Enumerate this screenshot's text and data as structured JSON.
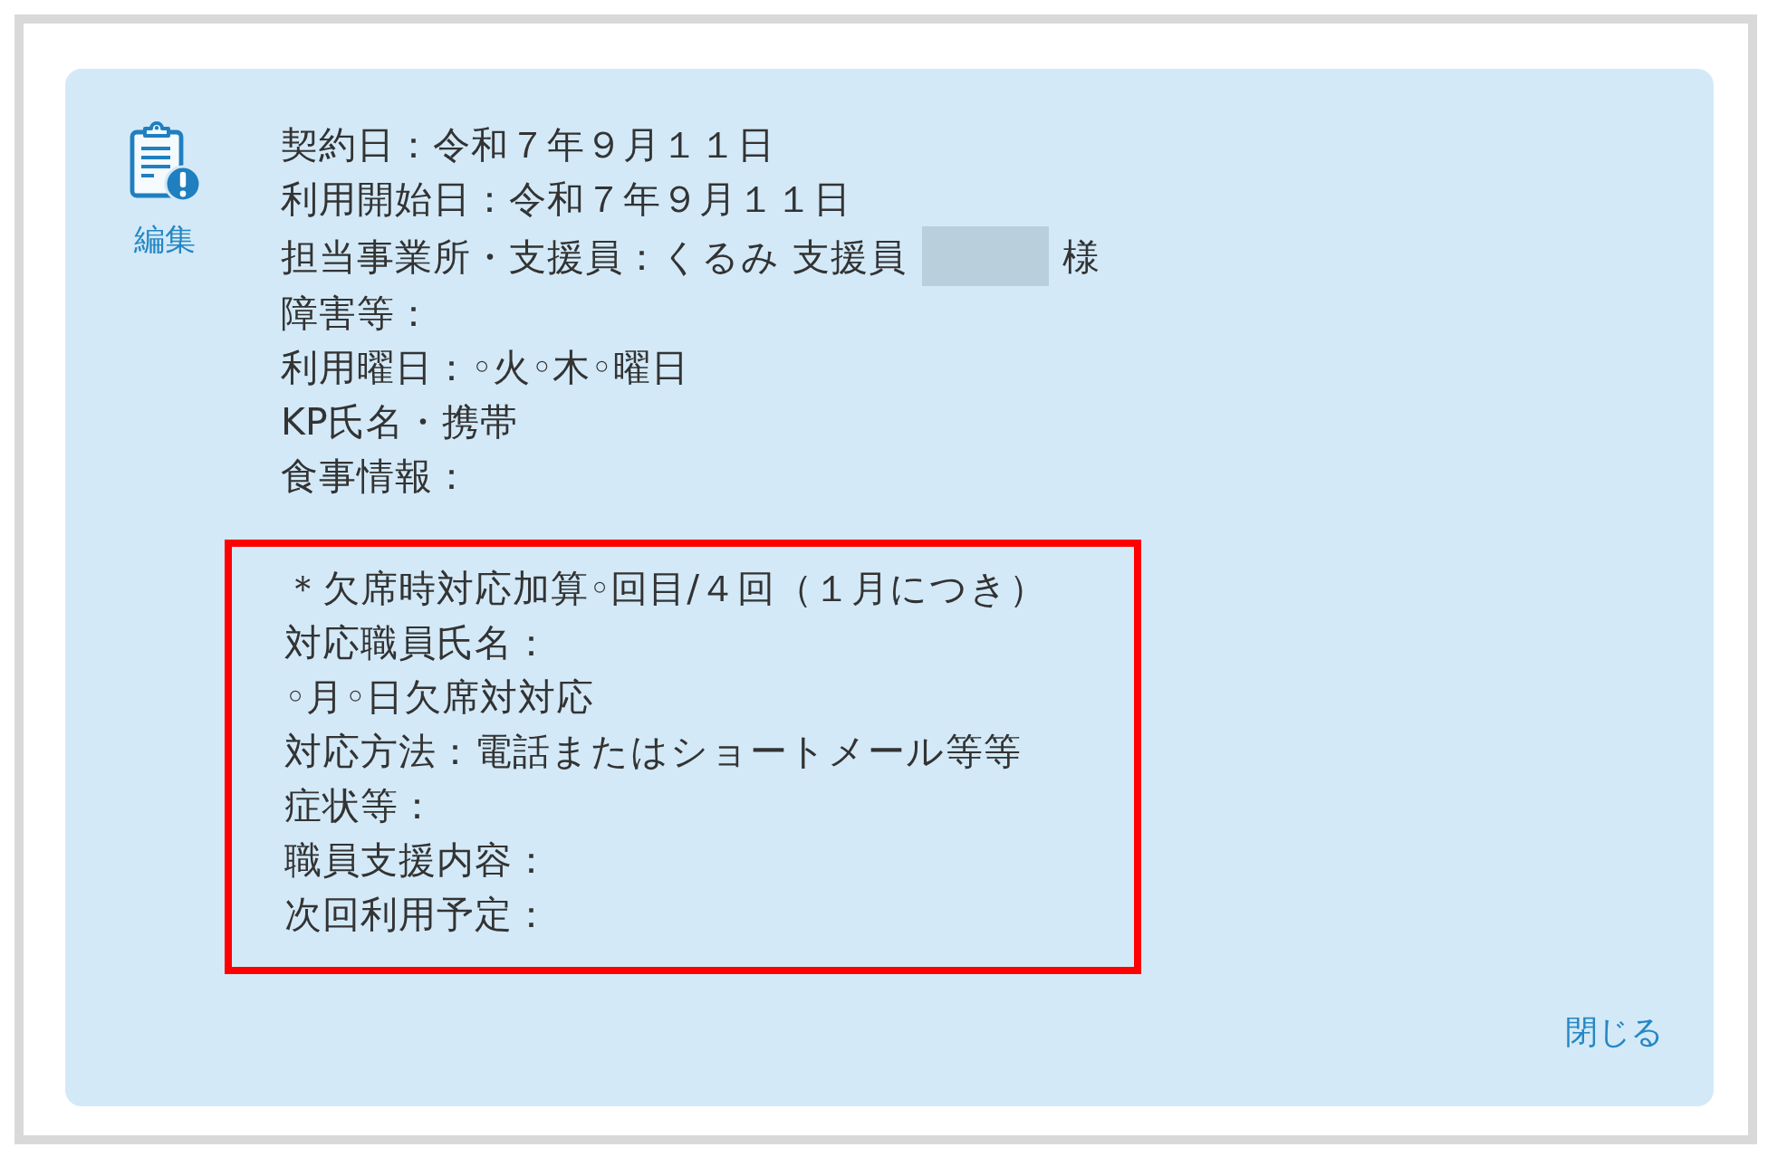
{
  "card": {
    "edit_link": {
      "label": "編集"
    },
    "info_lines": [
      {
        "kind": "text",
        "text": "契約日：令和７年９月１１日"
      },
      {
        "kind": "text",
        "text": "利用開始日：令和７年９月１１日"
      },
      {
        "kind": "redacted",
        "text": "担当事業所・支援員：くるみ 支援員",
        "suffix": "様"
      },
      {
        "kind": "text",
        "text": "障害等："
      },
      {
        "kind": "text",
        "text": "利用曜日：◦火◦木◦曜日"
      },
      {
        "kind": "text",
        "text": "KP氏名・携帯"
      },
      {
        "kind": "text",
        "text": "食事情報："
      }
    ],
    "notice_box": {
      "highlighted": true,
      "lines": [
        "＊欠席時対応加算◦回目/４回（１月につき）",
        "対応職員氏名：",
        "◦月◦日欠席対対応",
        "対応方法：電話またはショートメール等等",
        "症状等：",
        "職員支援内容：",
        "次回利用予定："
      ]
    },
    "close_link": {
      "label": "閉じる"
    }
  }
}
